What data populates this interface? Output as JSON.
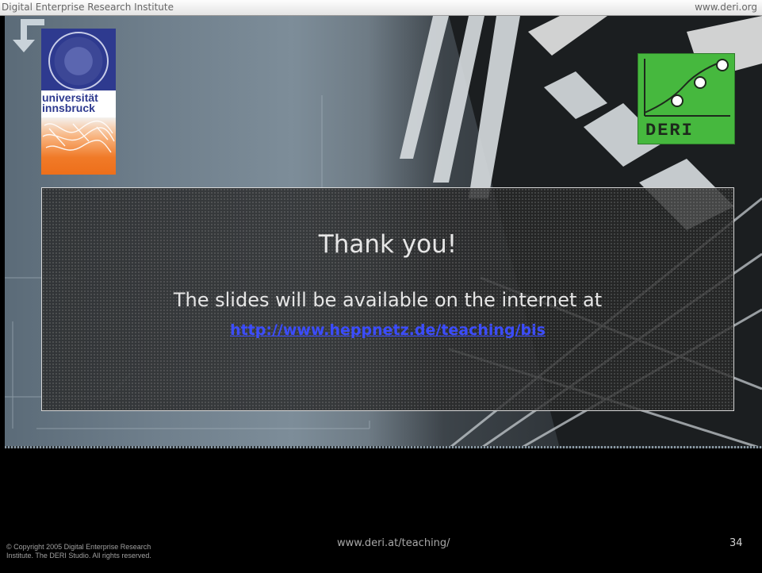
{
  "header": {
    "left_text": "Digital Enterprise Research Institute",
    "right_text": "www.deri.org"
  },
  "logos": {
    "university": {
      "line1": "universität",
      "line2": "innsbruck"
    },
    "deri": {
      "text": "DERI"
    }
  },
  "slide": {
    "title": "Thank you!",
    "subtitle": "The slides will be available on the internet at",
    "link": "http://www.heppnetz.de/teaching/bis"
  },
  "footer": {
    "copyright_line1": "© Copyright 2005 Digital Enterprise Research",
    "copyright_line2": "Institute. The DERI Studio. All rights reserved.",
    "url": "www.deri.at/teaching/",
    "page_number": "34"
  },
  "colors": {
    "link": "#3b4cff",
    "deri_green": "#46b83e",
    "uibk_blue": "#2e3a8f",
    "uibk_orange": "#f07a28"
  }
}
